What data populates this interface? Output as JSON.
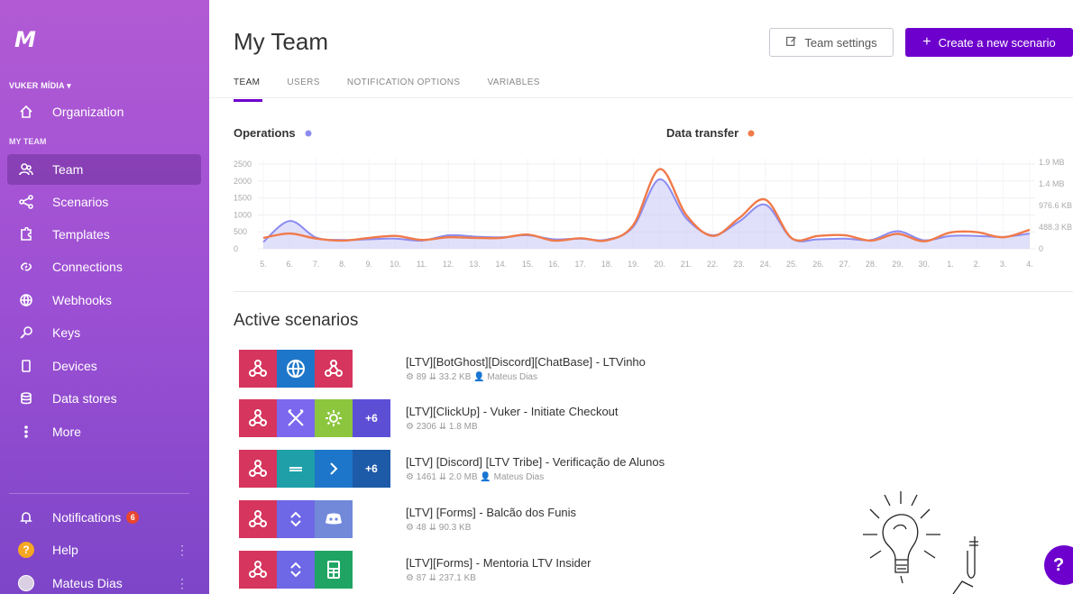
{
  "sidebar": {
    "logo": "M",
    "org_name": "VUKER MÍDIA ▾",
    "organization_label": "Organization",
    "section_label": "MY TEAM",
    "items": [
      {
        "label": "Team",
        "icon": "team-icon"
      },
      {
        "label": "Scenarios",
        "icon": "share-icon"
      },
      {
        "label": "Templates",
        "icon": "puzzle-icon"
      },
      {
        "label": "Connections",
        "icon": "link-icon"
      },
      {
        "label": "Webhooks",
        "icon": "globe-icon"
      },
      {
        "label": "Keys",
        "icon": "key-icon"
      },
      {
        "label": "Devices",
        "icon": "phone-icon"
      },
      {
        "label": "Data stores",
        "icon": "database-icon"
      },
      {
        "label": "More",
        "icon": "more-icon"
      }
    ],
    "notifications_label": "Notifications",
    "notifications_count": "6",
    "help_label": "Help",
    "user_label": "Mateus Dias"
  },
  "header": {
    "title": "My Team",
    "settings_label": "Team settings",
    "create_label": "Create a new scenario"
  },
  "tabs": [
    "TEAM",
    "USERS",
    "NOTIFICATION OPTIONS",
    "VARIABLES"
  ],
  "colors": {
    "accent": "#6d00cc",
    "operations": "#8b8bf0",
    "data_transfer": "#f07a4a",
    "webhook_app": "#d6355d",
    "http_app": "#1d76c9",
    "clickup_tools": "#7b68ee",
    "gear_app": "#8cc63f",
    "more_apps": "#5c4fd6",
    "router_app": "#6e67e6",
    "discord_app": "#7289da",
    "sheets_app": "#1fa463",
    "teal_app": "#1fa0a8"
  },
  "chart_data": {
    "type": "line",
    "title": "",
    "categories": [
      "5.",
      "6.",
      "7.",
      "8.",
      "9.",
      "10.",
      "11.",
      "12.",
      "13.",
      "14.",
      "15.",
      "16.",
      "17.",
      "18.",
      "19.",
      "20.",
      "21.",
      "22.",
      "23.",
      "24.",
      "25.",
      "26.",
      "27.",
      "28.",
      "29.",
      "30.",
      "1.",
      "2.",
      "3.",
      "4."
    ],
    "left_axis_ticks": [
      "2500",
      "2000",
      "1500",
      "1000",
      "500",
      "0"
    ],
    "right_axis_ticks": [
      "1.9 MB",
      "1.4 MB",
      "976.6 KB",
      "488.3 KB",
      "0"
    ],
    "ylim": [
      0,
      2500
    ],
    "grid": true,
    "series": [
      {
        "name": "Operations",
        "axis": "left",
        "values": [
          200,
          820,
          330,
          260,
          280,
          300,
          240,
          400,
          360,
          340,
          400,
          280,
          300,
          270,
          650,
          2050,
          900,
          400,
          800,
          1300,
          300,
          280,
          300,
          260,
          520,
          250,
          380,
          380,
          350,
          450
        ]
      },
      {
        "name": "Data transfer",
        "axis": "right",
        "values": [
          320,
          450,
          300,
          240,
          320,
          380,
          260,
          340,
          320,
          320,
          420,
          240,
          310,
          250,
          700,
          2350,
          1000,
          380,
          900,
          1450,
          310,
          380,
          400,
          240,
          440,
          220,
          480,
          490,
          340,
          560
        ]
      }
    ]
  },
  "active_scenarios_title": "Active scenarios",
  "scenarios": [
    {
      "name": "[LTV][BotGhost][Discord][ChatBase] - LTVinho",
      "ops": "89",
      "transfer": "33.2 KB",
      "owner": "Mateus Dias",
      "apps": [
        {
          "icon": "webhook-icon",
          "color": "#d6355d"
        },
        {
          "icon": "globe-icon",
          "color": "#1d76c9"
        },
        {
          "icon": "webhook-icon",
          "color": "#d6355d"
        }
      ]
    },
    {
      "name": "[LTV][ClickUp] - Vuker - Initiate Checkout",
      "ops": "2306",
      "transfer": "1.8 MB",
      "owner": "",
      "apps": [
        {
          "icon": "webhook-icon",
          "color": "#d6355d"
        },
        {
          "icon": "tools-icon",
          "color": "#7b68ee"
        },
        {
          "icon": "gear-icon",
          "color": "#8cc63f"
        },
        {
          "icon": "more-count",
          "color": "#5c4fd6",
          "text": "+6"
        }
      ]
    },
    {
      "name": "[LTV] [Discord] [LTV Tribe] - Verificação de Alunos",
      "ops": "1461",
      "transfer": "2.0 MB",
      "owner": "Mateus Dias",
      "apps": [
        {
          "icon": "webhook-icon",
          "color": "#d6355d"
        },
        {
          "icon": "teal-logo-icon",
          "color": "#1fa0a8"
        },
        {
          "icon": "chevron-right-icon",
          "color": "#1d76c9"
        },
        {
          "icon": "more-count",
          "color": "#1d5aa8",
          "text": "+6"
        }
      ]
    },
    {
      "name": "[LTV] [Forms] - Balcão dos Funis",
      "ops": "48",
      "transfer": "90.3 KB",
      "owner": "",
      "apps": [
        {
          "icon": "webhook-icon",
          "color": "#d6355d"
        },
        {
          "icon": "router-icon",
          "color": "#6e67e6"
        },
        {
          "icon": "discord-icon",
          "color": "#7289da"
        }
      ]
    },
    {
      "name": "[LTV][Forms] - Mentoria LTV Insider",
      "ops": "87",
      "transfer": "237.1 KB",
      "owner": "",
      "apps": [
        {
          "icon": "webhook-icon",
          "color": "#d6355d"
        },
        {
          "icon": "router-icon",
          "color": "#6e67e6"
        },
        {
          "icon": "sheets-icon",
          "color": "#1fa463"
        }
      ]
    }
  ],
  "help_fab_label": "?"
}
